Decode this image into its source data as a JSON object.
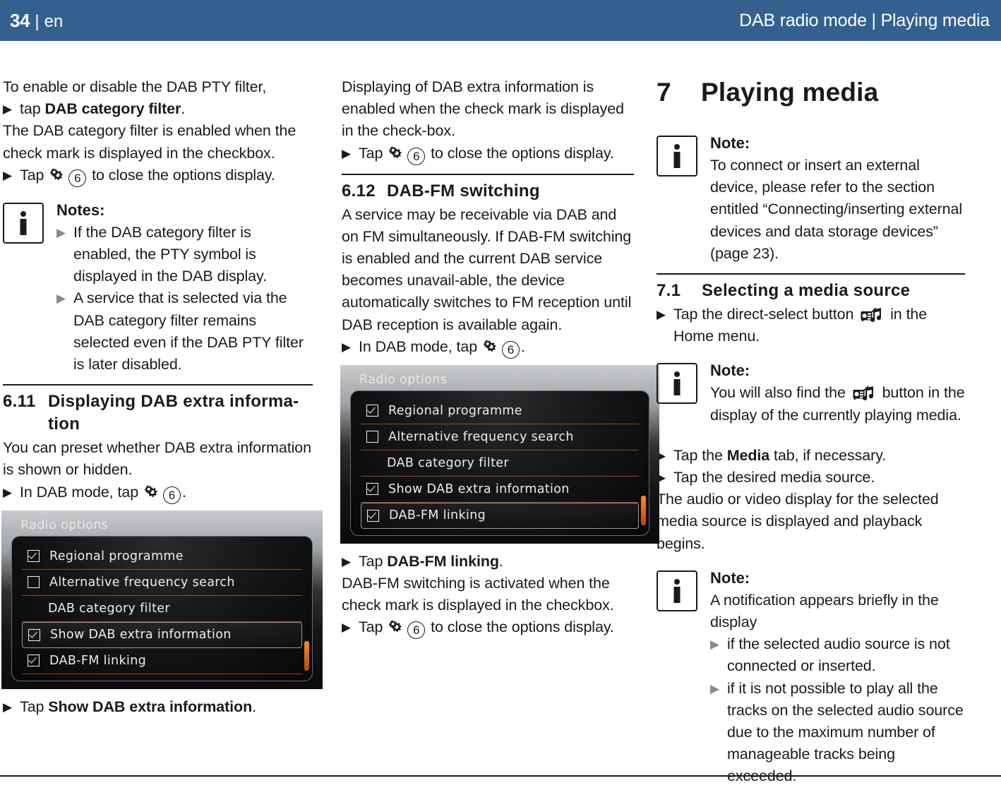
{
  "header": {
    "page_number": "34",
    "separator": "|",
    "language": "en",
    "section_title": "DAB radio mode | Playing media"
  },
  "column1": {
    "intro_line": "To enable or disable the DAB PTY filter,",
    "step_tap_prefix": "tap ",
    "step_tap_bold": "DAB category filter",
    "step_tap_suffix": ".",
    "para_enabled": "The DAB category filter is enabled when the check mark is displayed in the checkbox.",
    "step_close_prefix": "Tap ",
    "step_close_suffix": " to close the options display.",
    "circle_number": "6",
    "notes": {
      "title": "Notes:",
      "items": [
        "If the DAB category filter is enabled, the PTY symbol is displayed in the DAB display.",
        "A service that is selected via the DAB category filter remains selected even if the DAB PTY filter is later disabled."
      ]
    },
    "section": {
      "number": "6.11",
      "title": "Displaying DAB extra informa-",
      "title_line2": "tion"
    },
    "para_preset": "You can preset whether DAB extra information is shown or hidden.",
    "step_dabmode_prefix": "In DAB mode, tap ",
    "step_dabmode_suffix": ".",
    "device": {
      "title": "Radio options",
      "options": [
        {
          "label": "Regional programme",
          "checkbox": "checked",
          "selected": false
        },
        {
          "label": "Alternative frequency search",
          "checkbox": "unchecked",
          "selected": false
        },
        {
          "label": "DAB category filter",
          "checkbox": "none",
          "selected": false
        },
        {
          "label": "Show DAB extra information",
          "checkbox": "checked",
          "selected": true
        },
        {
          "label": "DAB-FM linking",
          "checkbox": "checked",
          "selected": false
        }
      ]
    },
    "step_tap_show_prefix": "Tap ",
    "step_tap_show_bold": "Show DAB extra information",
    "step_tap_show_suffix": "."
  },
  "column2": {
    "para_displaying": "Displaying of DAB extra information is enabled when the check mark is displayed in the check-box.",
    "step_close_prefix": "Tap ",
    "step_close_suffix": " to close the options display.",
    "circle_number": "6",
    "section": {
      "number": "6.12",
      "title": "DAB-FM switching"
    },
    "para_service": "A service may be receivable via DAB and on FM simultaneously. If DAB-FM switching is enabled and the current DAB service becomes unavail-able, the device automatically switches to FM reception until DAB reception is available again.",
    "step_dabmode_prefix": "In DAB mode, tap ",
    "step_dabmode_suffix": ".",
    "device": {
      "title": "Radio options",
      "options": [
        {
          "label": "Regional programme",
          "checkbox": "checked",
          "selected": false
        },
        {
          "label": "Alternative frequency search",
          "checkbox": "unchecked",
          "selected": false
        },
        {
          "label": "DAB category filter",
          "checkbox": "none",
          "selected": false
        },
        {
          "label": "Show DAB extra information",
          "checkbox": "checked",
          "selected": false
        },
        {
          "label": "DAB-FM linking",
          "checkbox": "checked",
          "selected": true
        }
      ]
    },
    "step_tap_linking_prefix": "Tap ",
    "step_tap_linking_bold": "DAB-FM linking",
    "step_tap_linking_suffix": ".",
    "para_activated": "DAB-FM switching is activated when the check mark is displayed in the checkbox.",
    "step_close2_prefix": "Tap ",
    "step_close2_suffix": " to close the options display."
  },
  "column3": {
    "chapter": {
      "number": "7",
      "title": "Playing media"
    },
    "note1": {
      "title": "Note:",
      "text": "To connect or insert an external device, please refer to the section entitled “Connecting/inserting external devices and data storage devices” (page 23)."
    },
    "section": {
      "number": "7.1",
      "title": "Selecting a media source"
    },
    "step_direct_prefix": "Tap the direct-select button ",
    "step_direct_suffix": " in the Home menu.",
    "note2": {
      "title": "Note:",
      "text_prefix": "You will also find the ",
      "text_suffix": " button in the display of the currently playing media."
    },
    "step_media_tab_prefix": "Tap the ",
    "step_media_tab_bold": "Media",
    "step_media_tab_suffix": " tab, if necessary.",
    "step_desired_source": "Tap the desired media source.",
    "para_audio_video": "The audio or video display for the selected media source is displayed and playback begins.",
    "note3": {
      "title": "Note:",
      "text": "A notification appears briefly in the display",
      "items": [
        "if the selected audio source is not connected or inserted.",
        "if it is not possible to play all the tracks on the selected audio source due to the maximum number of manageable tracks being exceeded."
      ]
    }
  },
  "colors": {
    "header_bg": "#34608f",
    "text": "#1a1a1a",
    "device_accent": "#c45c14",
    "grey_bullet": "#8a8a8a"
  }
}
